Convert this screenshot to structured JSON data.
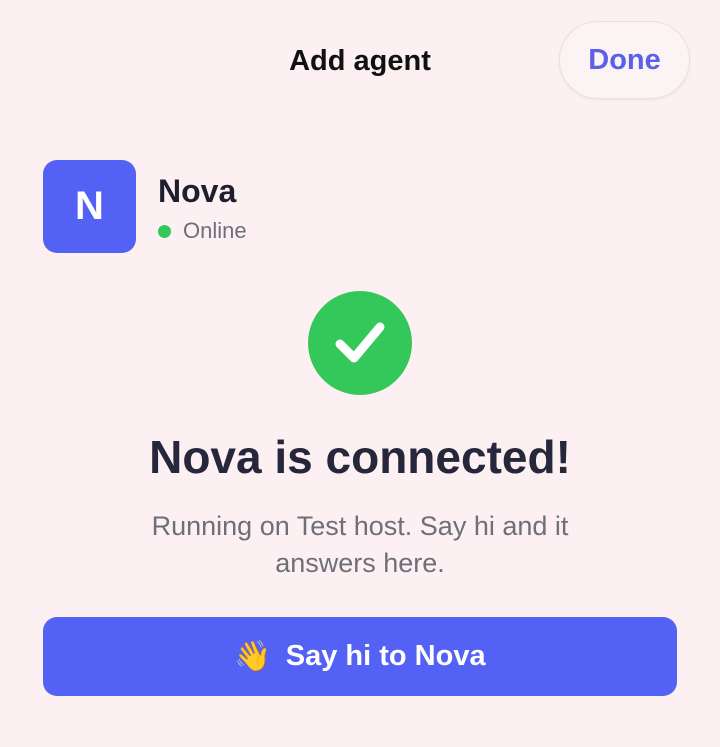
{
  "header": {
    "title": "Add agent",
    "done_label": "Done"
  },
  "agent": {
    "initial": "N",
    "name": "Nova",
    "status": "Online"
  },
  "confirmation": {
    "headline": "Nova is connected!",
    "subtext": "Running on Test host. Say hi and it answers here."
  },
  "cta": {
    "icon": "👋",
    "label": "Say hi to Nova"
  },
  "colors": {
    "background": "#fcf0f2",
    "accent": "#5361f5",
    "success": "#34c759",
    "done_text": "#5a61e6"
  },
  "icons": {
    "check": "checkmark-icon",
    "wave": "waving-hand-icon",
    "status": "online-dot-icon"
  }
}
